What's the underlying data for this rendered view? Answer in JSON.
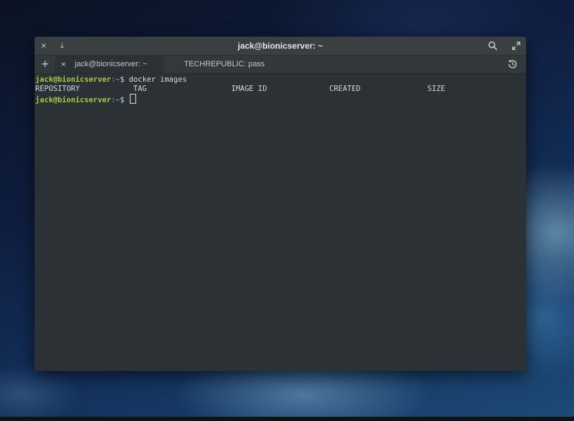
{
  "window": {
    "title": "jack@bionicserver: ~",
    "close_glyph": "×",
    "download_glyph": "⤓"
  },
  "tabs": [
    {
      "label": "jack@bionicserver: ~",
      "active": true
    },
    {
      "label": "TECHREPUBLIC: pass",
      "active": false
    }
  ],
  "tabbar": {
    "new_tab_glyph": "+",
    "tab_close_glyph": "×"
  },
  "terminal": {
    "prompt_user": "jack@bionicserver",
    "prompt_path": ":~",
    "prompt_symbol": "$ ",
    "command": "docker images",
    "columns": [
      "REPOSITORY",
      "TAG",
      "IMAGE ID",
      "CREATED",
      "SIZE"
    ]
  },
  "colors": {
    "prompt_user": "#a4cc3e",
    "prompt_path": "#7fa6d4",
    "terminal_bg": "#2b3134",
    "text": "#d6d9db"
  },
  "icons": [
    "close-icon",
    "download-icon",
    "search-icon",
    "maximize-icon",
    "add-tab-icon",
    "tab-close-icon",
    "history-icon"
  ]
}
